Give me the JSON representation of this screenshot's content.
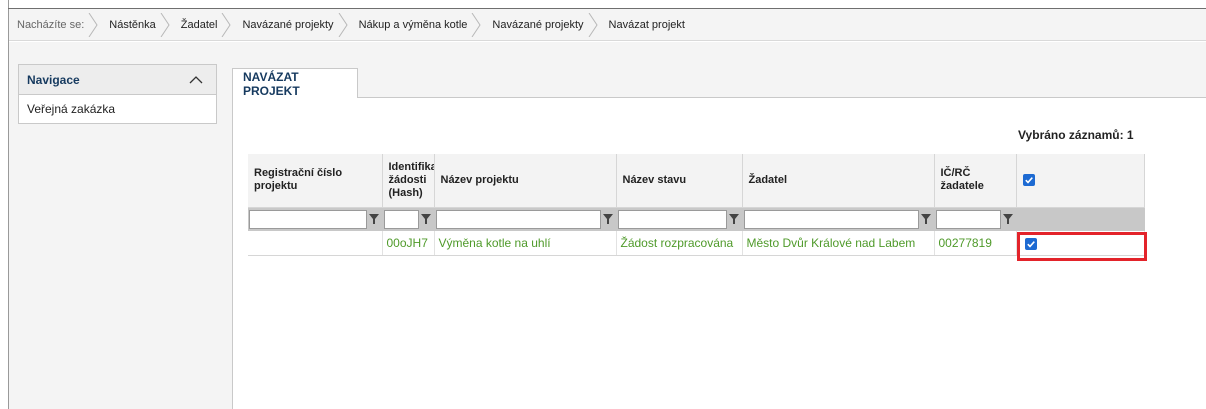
{
  "breadcrumb": {
    "label": "Nacházíte se:",
    "items": [
      "Nástěnka",
      "Žadatel",
      "Navázané projekty",
      "Nákup a výměna kotle",
      "Navázané projekty",
      "Navázat projekt"
    ]
  },
  "navigation": {
    "title": "Navigace",
    "items": [
      "Veřejná zakázka"
    ]
  },
  "tab": {
    "label": "NAVÁZAT PROJEKT"
  },
  "selected_count": "Vybráno záznamů: 1",
  "table": {
    "columns": [
      "Registrační číslo projektu",
      "Identifikace žádosti (Hash)",
      "Název projektu",
      "Název stavu",
      "Žadatel",
      "IČ/RČ žadatele"
    ],
    "select_all_checked": true,
    "rows": [
      {
        "registration_number": "",
        "hash": "00oJH7",
        "project_name": "Výměna kotle na uhlí",
        "state": "Žádost rozpracována",
        "applicant": "Město Dvůr Králové nad Labem",
        "ic": "00277819",
        "checked": true
      }
    ]
  },
  "colors": {
    "accent_blue": "#1d6ad2",
    "link_green": "#4f9a2a",
    "highlight_red": "#e3232a",
    "header_navy": "#163a5f"
  }
}
